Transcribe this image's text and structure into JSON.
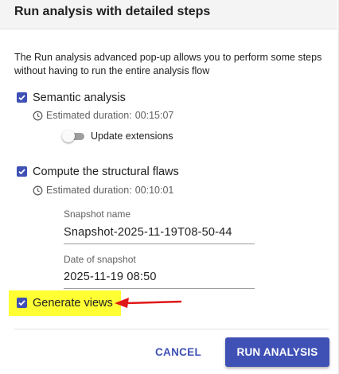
{
  "dialog": {
    "title": "Run analysis with detailed steps",
    "intro": "The Run analysis advanced pop-up allows you to perform some steps without having to run the entire analysis flow"
  },
  "steps": [
    {
      "label": "Semantic analysis",
      "checked": true,
      "duration_label": "Estimated duration:",
      "duration_value": "00:15:07",
      "toggle": {
        "label": "Update extensions",
        "on": false
      }
    },
    {
      "label": "Compute the structural flaws",
      "checked": true,
      "duration_label": "Estimated duration:",
      "duration_value": "00:10:01",
      "fields": [
        {
          "label": "Snapshot name",
          "value": "Snapshot-2025-11-19T08-50-44"
        },
        {
          "label": "Date of snapshot",
          "value": "2025-11-19 08:50"
        }
      ]
    },
    {
      "label": "Generate views",
      "checked": true,
      "highlighted": true
    }
  ],
  "actions": {
    "cancel": "CANCEL",
    "run": "RUN ANALYSIS"
  },
  "colors": {
    "accent": "#3f51b5",
    "highlight": "#ffff33",
    "annotation_arrow": "#e01818"
  },
  "icons": {
    "checkbox": "checkbox-checked-icon",
    "clock": "clock-icon",
    "arrow": "annotation-arrow-icon"
  }
}
